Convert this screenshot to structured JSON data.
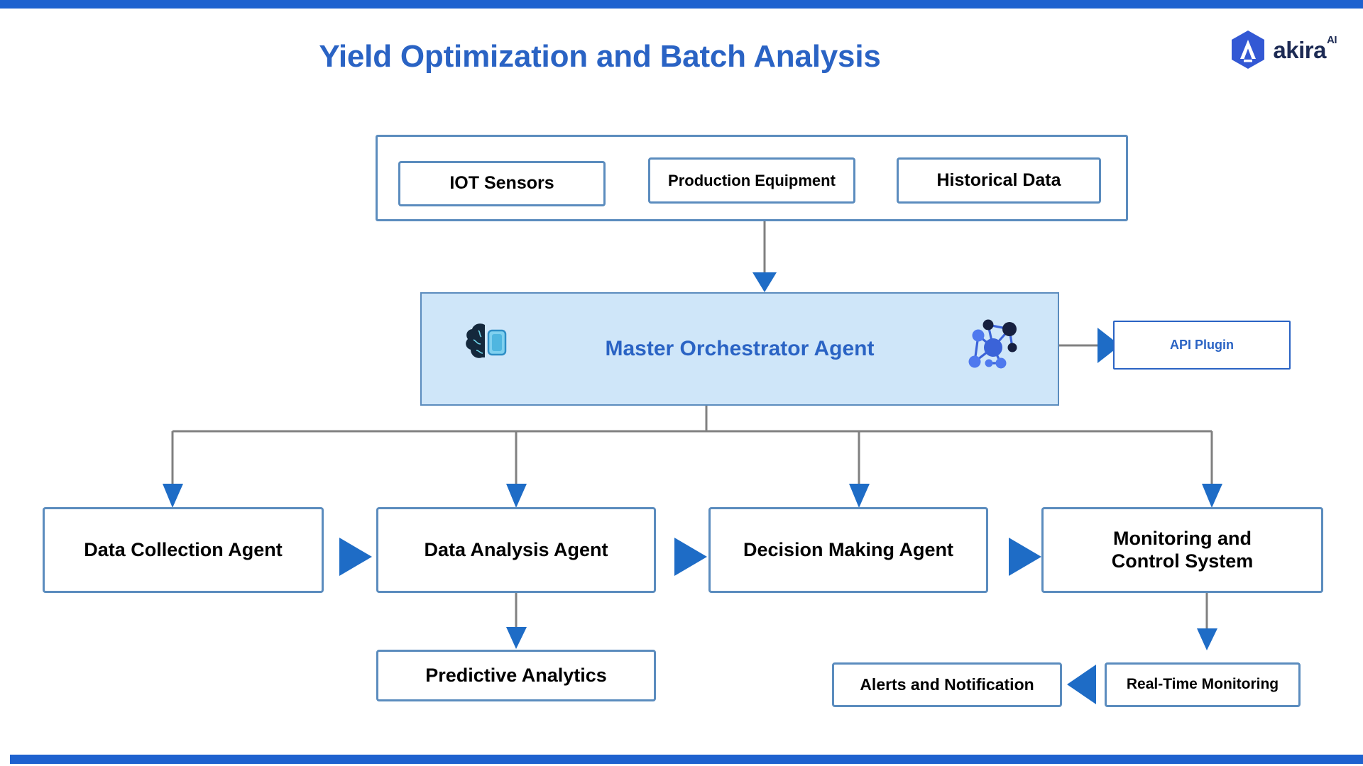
{
  "page": {
    "title": "Yield Optimization and Batch Analysis",
    "accent_color": "#1e62cf",
    "title_color": "#2a63c4",
    "node_border_color": "#5b8cbe",
    "orchestrator_fill": "#cfe6f9",
    "wire_color": "#808080",
    "arrow_color": "#1e6cc6"
  },
  "brand": {
    "name": "akira",
    "superscript": "AI",
    "mark_icon": "akira-hexagon-logo-icon"
  },
  "inputs_group": {
    "items": [
      {
        "label": "IOT Sensors"
      },
      {
        "label": "Production Equipment"
      },
      {
        "label": "Historical Data"
      }
    ]
  },
  "orchestrator": {
    "label": "Master Orchestrator Agent",
    "left_icon": "brain-chip-icon",
    "right_icon": "network-graph-icon"
  },
  "api_plugin": {
    "label": "API Plugin"
  },
  "agents": [
    {
      "label": "Data Collection Agent"
    },
    {
      "label": "Data Analysis Agent"
    },
    {
      "label": "Decision Making Agent"
    },
    {
      "label": "Monitoring and\nControl System"
    }
  ],
  "outputs": {
    "predictive": {
      "label": "Predictive Analytics"
    },
    "alerts": {
      "label": "Alerts and Notification"
    },
    "realtime": {
      "label": "Real-Time Monitoring"
    }
  }
}
